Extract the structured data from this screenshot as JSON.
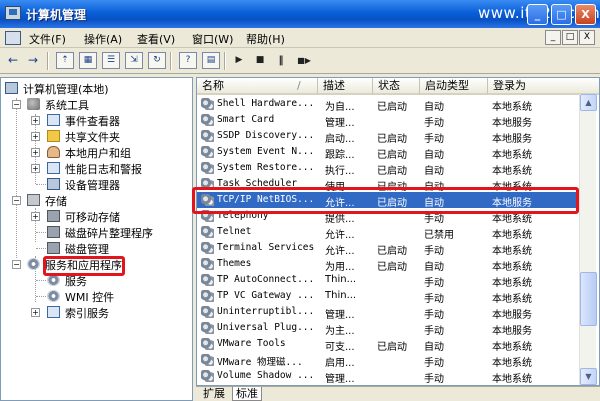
{
  "window": {
    "title": "计算机管理",
    "watermark": "www.it528.com"
  },
  "window_controls": {
    "minimize": "_",
    "maximize": "□",
    "close": "X"
  },
  "menubar": {
    "items": [
      "文件(F)",
      "操作(A)",
      "查看(V)",
      "窗口(W)",
      "帮助(H)"
    ],
    "mdi_controls": [
      "_",
      "□",
      "X"
    ]
  },
  "toolbar": {
    "back": "←",
    "forward": "→",
    "play": "▶",
    "stop": "■",
    "pause": "‖",
    "restart": "■▶"
  },
  "tree": {
    "root": "计算机管理(本地)",
    "system_tools": "系统工具",
    "event_viewer": "事件查看器",
    "shared_folders": "共享文件夹",
    "local_users": "本地用户和组",
    "perf_logs": "性能日志和警报",
    "device_manager": "设备管理器",
    "storage": "存储",
    "removable": "可移动存储",
    "defrag": "磁盘碎片整理程序",
    "disk_mgmt": "磁盘管理",
    "services_apps": "服务和应用程序",
    "services": "服务",
    "wmi": "WMI 控件",
    "indexing": "索引服务",
    "expander_minus": "−",
    "expander_plus": "+"
  },
  "list": {
    "columns": [
      "名称",
      "描述",
      "状态",
      "启动类型",
      "登录为"
    ],
    "sort_arrow": "/",
    "rows": [
      {
        "name": "Shell Hardware...",
        "desc": "为自...",
        "status": "已启动",
        "startup": "自动",
        "logon": "本地系统"
      },
      {
        "name": "Smart Card",
        "desc": "管理...",
        "status": "",
        "startup": "手动",
        "logon": "本地服务"
      },
      {
        "name": "SSDP Discovery...",
        "desc": "启动...",
        "status": "已启动",
        "startup": "手动",
        "logon": "本地服务"
      },
      {
        "name": "System Event N...",
        "desc": "跟踪...",
        "status": "已启动",
        "startup": "自动",
        "logon": "本地系统"
      },
      {
        "name": "System Restore...",
        "desc": "执行...",
        "status": "已启动",
        "startup": "自动",
        "logon": "本地系统"
      },
      {
        "name": "Task Scheduler",
        "desc": "使用...",
        "status": "已启动",
        "startup": "自动",
        "logon": "本地系统"
      },
      {
        "name": "TCP/IP NetBIOS...",
        "desc": "允许...",
        "status": "已启动",
        "startup": "自动",
        "logon": "本地服务"
      },
      {
        "name": "Telephony",
        "desc": "提供...",
        "status": "",
        "startup": "手动",
        "logon": "本地系统"
      },
      {
        "name": "Telnet",
        "desc": "允许...",
        "status": "",
        "startup": "已禁用",
        "logon": "本地系统"
      },
      {
        "name": "Terminal Services",
        "desc": "允许...",
        "status": "已启动",
        "startup": "手动",
        "logon": "本地系统"
      },
      {
        "name": "Themes",
        "desc": "为用...",
        "status": "已启动",
        "startup": "自动",
        "logon": "本地系统"
      },
      {
        "name": "TP AutoConnect...",
        "desc": "Thin...",
        "status": "",
        "startup": "手动",
        "logon": "本地系统"
      },
      {
        "name": "TP VC Gateway ...",
        "desc": "Thin...",
        "status": "",
        "startup": "手动",
        "logon": "本地系统"
      },
      {
        "name": "Uninterruptibl...",
        "desc": "管理...",
        "status": "",
        "startup": "手动",
        "logon": "本地服务"
      },
      {
        "name": "Universal Plug...",
        "desc": "为主...",
        "status": "",
        "startup": "手动",
        "logon": "本地服务"
      },
      {
        "name": "VMware Tools",
        "desc": "可支...",
        "status": "已启动",
        "startup": "自动",
        "logon": "本地系统"
      },
      {
        "name": "VMware 物理磁...",
        "desc": "启用...",
        "status": "",
        "startup": "手动",
        "logon": "本地系统"
      },
      {
        "name": "Volume Shadow ...",
        "desc": "管理...",
        "status": "",
        "startup": "手动",
        "logon": "本地系统"
      }
    ]
  },
  "scrollbar": {
    "up": "▲",
    "down": "▼"
  },
  "tabs": {
    "extended": "扩展",
    "standard": "标准"
  },
  "colors": {
    "selection": "#316ac5",
    "annotation_red": "#e2141c",
    "titlebar_blue": "#0a5fd8"
  }
}
